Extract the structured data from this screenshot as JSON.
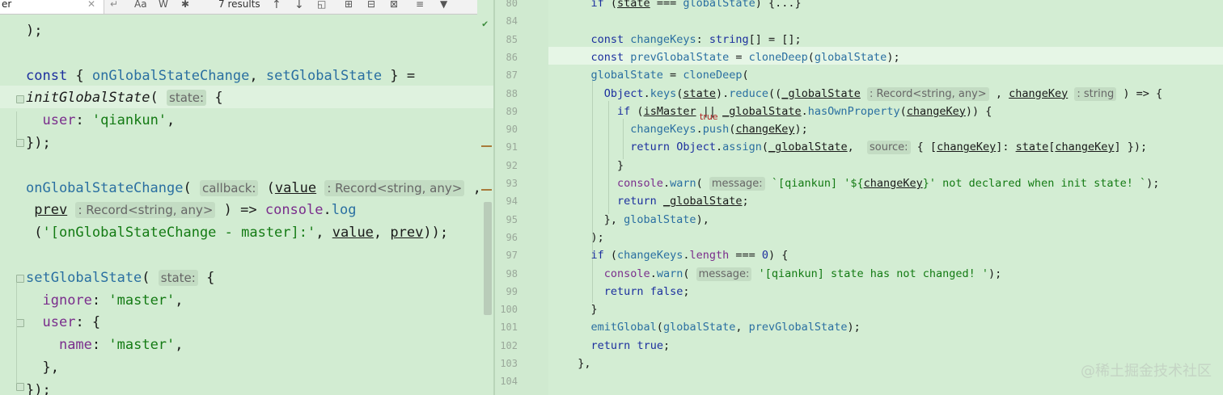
{
  "search": {
    "query": "er",
    "results": "7 results",
    "options": [
      "Aa",
      "W",
      "✱"
    ]
  },
  "left": {
    "lines": [
      {
        "tokens": [
          {
            "t": ");"
          }
        ]
      },
      {
        "tokens": []
      },
      {
        "tokens": [
          {
            "t": "const",
            "c": "kw"
          },
          {
            "t": " { "
          },
          {
            "t": "onGlobalStateChange",
            "c": "fn"
          },
          {
            "t": ", "
          },
          {
            "t": "setGlobalState",
            "c": "fn"
          },
          {
            "t": " } ="
          }
        ]
      },
      {
        "tokens": [
          {
            "t": "initGlobalState",
            "c": "ital"
          },
          {
            "t": "( "
          },
          {
            "t": "state:",
            "c": "hint"
          },
          {
            "t": " {"
          }
        ]
      },
      {
        "tokens": [
          {
            "t": "  "
          },
          {
            "t": "user",
            "c": "prop"
          },
          {
            "t": ": "
          },
          {
            "t": "'qiankun'",
            "c": "str"
          },
          {
            "t": ","
          }
        ]
      },
      {
        "tokens": [
          {
            "t": "});"
          }
        ]
      },
      {
        "tokens": []
      },
      {
        "tokens": [
          {
            "t": "onGlobalStateChange",
            "c": "fn"
          },
          {
            "t": "( "
          },
          {
            "t": "callback:",
            "c": "hint"
          },
          {
            "t": " ("
          },
          {
            "t": "value",
            "c": "ul"
          },
          {
            "t": " "
          },
          {
            "t": ": Record<string, any>",
            "c": "hint"
          },
          {
            "t": " ,"
          }
        ]
      },
      {
        "tokens": [
          {
            "t": " "
          },
          {
            "t": "prev",
            "c": "ul"
          },
          {
            "t": " "
          },
          {
            "t": ": Record<string, any>",
            "c": "hint"
          },
          {
            "t": " ) => "
          },
          {
            "t": "console",
            "c": "prop"
          },
          {
            "t": "."
          },
          {
            "t": "log",
            "c": "fn"
          }
        ]
      },
      {
        "tokens": [
          {
            "t": " ("
          },
          {
            "t": "'[onGlobalStateChange - master]:'",
            "c": "str"
          },
          {
            "t": ", "
          },
          {
            "t": "value",
            "c": "ul"
          },
          {
            "t": ", "
          },
          {
            "t": "prev",
            "c": "ul"
          },
          {
            "t": "));"
          }
        ]
      },
      {
        "tokens": []
      },
      {
        "tokens": [
          {
            "t": "setGlobalState",
            "c": "fn"
          },
          {
            "t": "( "
          },
          {
            "t": "state:",
            "c": "hint"
          },
          {
            "t": " {"
          }
        ]
      },
      {
        "tokens": [
          {
            "t": "  "
          },
          {
            "t": "ignore",
            "c": "prop"
          },
          {
            "t": ": "
          },
          {
            "t": "'master'",
            "c": "str"
          },
          {
            "t": ","
          }
        ]
      },
      {
        "tokens": [
          {
            "t": "  "
          },
          {
            "t": "user",
            "c": "prop"
          },
          {
            "t": ": {"
          }
        ]
      },
      {
        "tokens": [
          {
            "t": "    "
          },
          {
            "t": "name",
            "c": "prop"
          },
          {
            "t": ": "
          },
          {
            "t": "'master'",
            "c": "str"
          },
          {
            "t": ","
          }
        ]
      },
      {
        "tokens": [
          {
            "t": "  },"
          }
        ]
      },
      {
        "tokens": [
          {
            "t": "});"
          }
        ]
      }
    ]
  },
  "right": {
    "lines": [
      {
        "n": "80",
        "tokens": [
          {
            "t": "    "
          },
          {
            "t": "if",
            "c": "kw"
          },
          {
            "t": " ("
          },
          {
            "t": "state",
            "c": "ul"
          },
          {
            "t": " === "
          },
          {
            "t": "globalState",
            "c": "fn"
          },
          {
            "t": ") {...}"
          }
        ]
      },
      {
        "n": "84",
        "tokens": []
      },
      {
        "n": "85",
        "tokens": [
          {
            "t": "    "
          },
          {
            "t": "const",
            "c": "kw"
          },
          {
            "t": " "
          },
          {
            "t": "changeKeys",
            "c": "fn"
          },
          {
            "t": ": "
          },
          {
            "t": "string",
            "c": "kw"
          },
          {
            "t": "[] = [];"
          }
        ]
      },
      {
        "n": "86",
        "tokens": [
          {
            "t": "    "
          },
          {
            "t": "const",
            "c": "kw"
          },
          {
            "t": " "
          },
          {
            "t": "prevGlobalState",
            "c": "fn"
          },
          {
            "t": " = "
          },
          {
            "t": "cloneDeep",
            "c": "fn"
          },
          {
            "t": "("
          },
          {
            "t": "globalState",
            "c": "fn"
          },
          {
            "t": ");"
          }
        ]
      },
      {
        "n": "87",
        "tokens": [
          {
            "t": "    "
          },
          {
            "t": "globalState",
            "c": "fn"
          },
          {
            "t": " = "
          },
          {
            "t": "cloneDeep",
            "c": "fn"
          },
          {
            "t": "("
          }
        ]
      },
      {
        "n": "88",
        "tokens": [
          {
            "t": "      "
          },
          {
            "t": "Object",
            "c": "kw"
          },
          {
            "t": "."
          },
          {
            "t": "keys",
            "c": "fn"
          },
          {
            "t": "("
          },
          {
            "t": "state",
            "c": "ul"
          },
          {
            "t": ")."
          },
          {
            "t": "reduce",
            "c": "fn"
          },
          {
            "t": "(("
          },
          {
            "t": "_globalState",
            "c": "ul"
          },
          {
            "t": " "
          },
          {
            "t": ": Record<string, any>",
            "c": "hint"
          },
          {
            "t": " , "
          },
          {
            "t": "changeKey",
            "c": "ul"
          },
          {
            "t": " "
          },
          {
            "t": ": string",
            "c": "hint"
          },
          {
            "t": " ) => {"
          }
        ]
      },
      {
        "n": "89",
        "tokens": [
          {
            "t": "        "
          },
          {
            "t": "if",
            "c": "kw"
          },
          {
            "t": " ("
          },
          {
            "t": "isMaster",
            "c": "ul"
          },
          {
            "t": " || "
          },
          {
            "t": "_globalState",
            "c": "ul"
          },
          {
            "t": "."
          },
          {
            "t": "hasOwnProperty",
            "c": "fn"
          },
          {
            "t": "("
          },
          {
            "t": "changeKey",
            "c": "ul"
          },
          {
            "t": ")) {"
          }
        ]
      },
      {
        "n": "90",
        "tokens": [
          {
            "t": "          "
          },
          {
            "t": "changeKeys",
            "c": "fn"
          },
          {
            "t": "."
          },
          {
            "t": "push",
            "c": "fn"
          },
          {
            "t": "("
          },
          {
            "t": "changeKey",
            "c": "ul"
          },
          {
            "t": ");"
          }
        ]
      },
      {
        "n": "91",
        "tokens": [
          {
            "t": "          "
          },
          {
            "t": "return",
            "c": "kw"
          },
          {
            "t": " "
          },
          {
            "t": "Object",
            "c": "kw"
          },
          {
            "t": "."
          },
          {
            "t": "assign",
            "c": "fn"
          },
          {
            "t": "("
          },
          {
            "t": "_globalState",
            "c": "ul"
          },
          {
            "t": ",  "
          },
          {
            "t": "source:",
            "c": "hint"
          },
          {
            "t": " { ["
          },
          {
            "t": "changeKey",
            "c": "ul"
          },
          {
            "t": "]: "
          },
          {
            "t": "state",
            "c": "ul"
          },
          {
            "t": "["
          },
          {
            "t": "changeKey",
            "c": "ul"
          },
          {
            "t": "] });"
          }
        ]
      },
      {
        "n": "92",
        "tokens": [
          {
            "t": "        }"
          }
        ]
      },
      {
        "n": "93",
        "tokens": [
          {
            "t": "        "
          },
          {
            "t": "console",
            "c": "prop"
          },
          {
            "t": "."
          },
          {
            "t": "warn",
            "c": "fn"
          },
          {
            "t": "( "
          },
          {
            "t": "message:",
            "c": "hint"
          },
          {
            "t": " "
          },
          {
            "t": "`[qiankun] '${",
            "c": "str"
          },
          {
            "t": "changeKey",
            "c": "ul"
          },
          {
            "t": "}' not declared when init state! `",
            "c": "str"
          },
          {
            "t": ");"
          }
        ]
      },
      {
        "n": "94",
        "tokens": [
          {
            "t": "        "
          },
          {
            "t": "return",
            "c": "kw"
          },
          {
            "t": " "
          },
          {
            "t": "_globalState",
            "c": "ul"
          },
          {
            "t": ";"
          }
        ]
      },
      {
        "n": "95",
        "tokens": [
          {
            "t": "      }, "
          },
          {
            "t": "globalState",
            "c": "fn"
          },
          {
            "t": "),"
          }
        ]
      },
      {
        "n": "96",
        "tokens": [
          {
            "t": "    );"
          }
        ]
      },
      {
        "n": "97",
        "tokens": [
          {
            "t": "    "
          },
          {
            "t": "if",
            "c": "kw"
          },
          {
            "t": " ("
          },
          {
            "t": "changeKeys",
            "c": "fn"
          },
          {
            "t": "."
          },
          {
            "t": "length",
            "c": "prop"
          },
          {
            "t": " === "
          },
          {
            "t": "0",
            "c": "num"
          },
          {
            "t": ") {"
          }
        ]
      },
      {
        "n": "98",
        "tokens": [
          {
            "t": "      "
          },
          {
            "t": "console",
            "c": "prop"
          },
          {
            "t": "."
          },
          {
            "t": "warn",
            "c": "fn"
          },
          {
            "t": "( "
          },
          {
            "t": "message:",
            "c": "hint"
          },
          {
            "t": " "
          },
          {
            "t": "'[qiankun] state has not changed! '",
            "c": "str"
          },
          {
            "t": ");"
          }
        ]
      },
      {
        "n": "99",
        "tokens": [
          {
            "t": "      "
          },
          {
            "t": "return",
            "c": "kw"
          },
          {
            "t": " "
          },
          {
            "t": "false",
            "c": "kw"
          },
          {
            "t": ";"
          }
        ]
      },
      {
        "n": "100",
        "tokens": [
          {
            "t": "    }"
          }
        ]
      },
      {
        "n": "101",
        "tokens": [
          {
            "t": "    "
          },
          {
            "t": "emitGlobal",
            "c": "fn"
          },
          {
            "t": "("
          },
          {
            "t": "globalState",
            "c": "fn"
          },
          {
            "t": ", "
          },
          {
            "t": "prevGlobalState",
            "c": "fn"
          },
          {
            "t": ");"
          }
        ]
      },
      {
        "n": "102",
        "tokens": [
          {
            "t": "    "
          },
          {
            "t": "return",
            "c": "kw"
          },
          {
            "t": " "
          },
          {
            "t": "true",
            "c": "kw"
          },
          {
            "t": ";"
          }
        ]
      },
      {
        "n": "103",
        "tokens": [
          {
            "t": "  },"
          }
        ]
      },
      {
        "n": "104",
        "tokens": []
      }
    ],
    "inline_value": "true",
    "watermark": "@稀土掘金技术社区"
  }
}
